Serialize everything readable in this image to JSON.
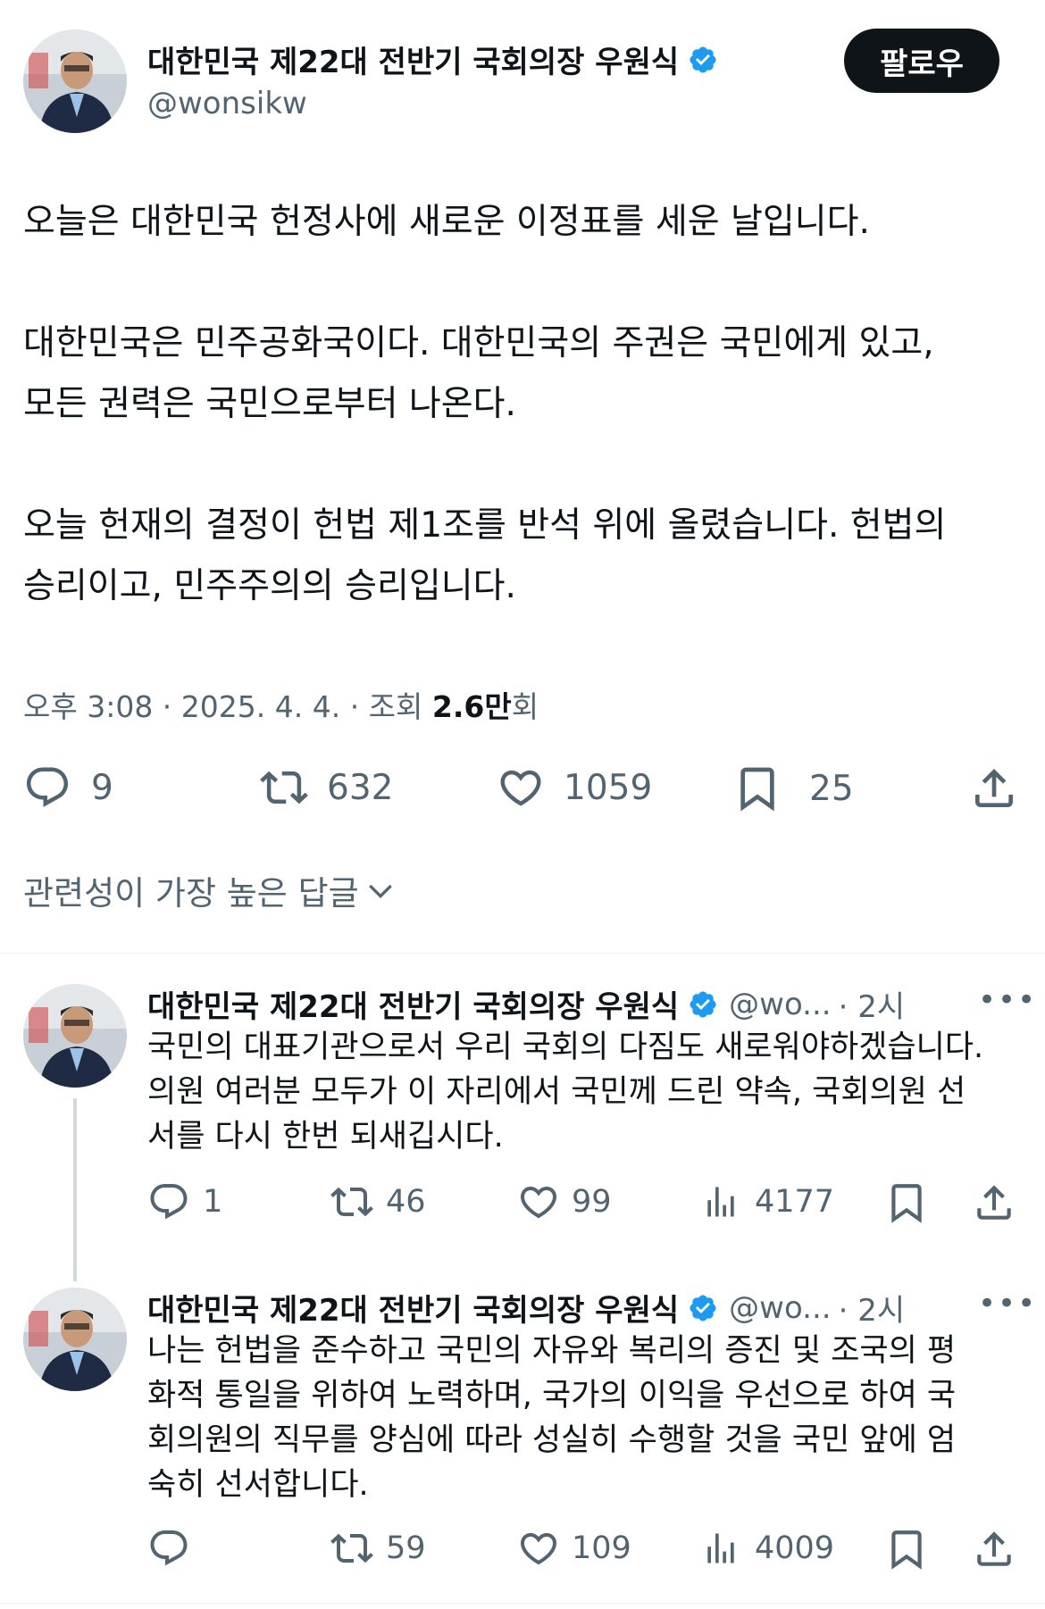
{
  "tweet": {
    "author_name": "대한민국 제22대 전반기 국회의장 우원식",
    "handle": "@wonsikw",
    "follow_label": "팔로우",
    "body": "오늘은 대한민국 헌정사에 새로운 이정표를 세운 날입니다.\n\n대한민국은 민주공화국이다. 대한민국의 주권은 국민에게 있고,\n모든 권력은 국민으로부터 나온다.\n\n오늘 헌재의 결정이 헌법 제1조를 반석 위에 올렸습니다. 헌법의\n승리이고, 민주주의의 승리입니다.",
    "time": "오후 3:08 · 2025. 4. 4. · 조회",
    "views": "2.6만",
    "views_suffix": "회",
    "replies": "9",
    "retweets": "632",
    "likes": "1059",
    "bookmarks": "25"
  },
  "replies_header": "관련성이 가장 높은 답글",
  "replies": [
    {
      "author_name": "대한민국 제22대 전반기 국회의장 우원식",
      "handle": "@wo...",
      "time": "· 2시",
      "text": "국민의 대표기관으로서 우리 국회의 다짐도 새로워야하겠습니다.\n의원 여러분 모두가 이 자리에서 국민께 드린 약속, 국회의원 선\n서를 다시 한번 되새깁시다.",
      "replies": "1",
      "retweets": "46",
      "likes": "99",
      "views": "4177"
    },
    {
      "author_name": "대한민국 제22대 전반기 국회의장 우원식",
      "handle": "@wo...",
      "time": "· 2시",
      "text": "나는 헌법을 준수하고 국민의 자유와 복리의 증진 및 조국의 평\n화적 통일을 위하여 노력하며, 국가의 이익을 우선으로 하여 국\n회의원의 직무를 양심에 따라 성실히 수행할 것을 국민 앞에 엄\n숙히 선서합니다.",
      "replies": "",
      "retweets": "59",
      "likes": "109",
      "views": "4009"
    }
  ],
  "colors": {
    "verified": "#1d9bf0",
    "muted": "#536471",
    "text": "#0f1419"
  },
  "icons": [
    "verified-badge-icon",
    "reply-icon",
    "retweet-icon",
    "like-icon",
    "bookmark-icon",
    "share-icon",
    "views-icon",
    "more-icon",
    "chevron-down-icon"
  ]
}
